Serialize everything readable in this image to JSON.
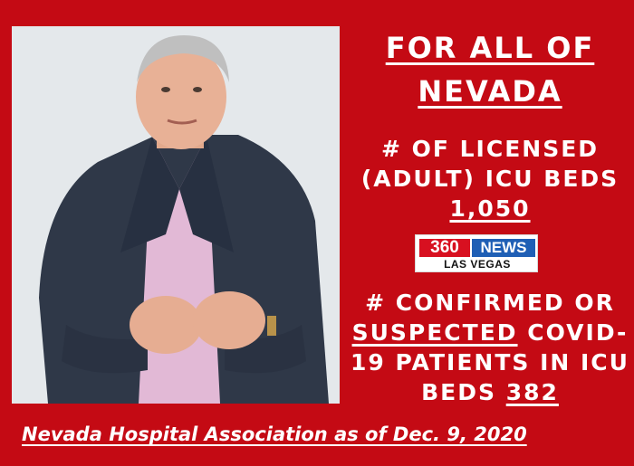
{
  "heading": {
    "line1": "FOR ALL OF",
    "line2": "NEVADA"
  },
  "icu_beds": {
    "line1": "# OF LICENSED",
    "line2": "(ADULT) ICU BEDS",
    "value": "1,050"
  },
  "logo": {
    "number": "360",
    "brand": "NEWS",
    "city": "LAS VEGAS"
  },
  "covid_patients": {
    "line1": "# CONFIRMED OR",
    "line2_underlined": "SUSPECTED",
    "line2_rest": " COVID-",
    "line3": "19 PATIENTS IN ICU",
    "line4_prefix": "BEDS ",
    "value": "382"
  },
  "source": "Nevada Hospital Association as of Dec. 9, 2020",
  "colors": {
    "background": "#c40a14",
    "text": "#ffffff"
  }
}
